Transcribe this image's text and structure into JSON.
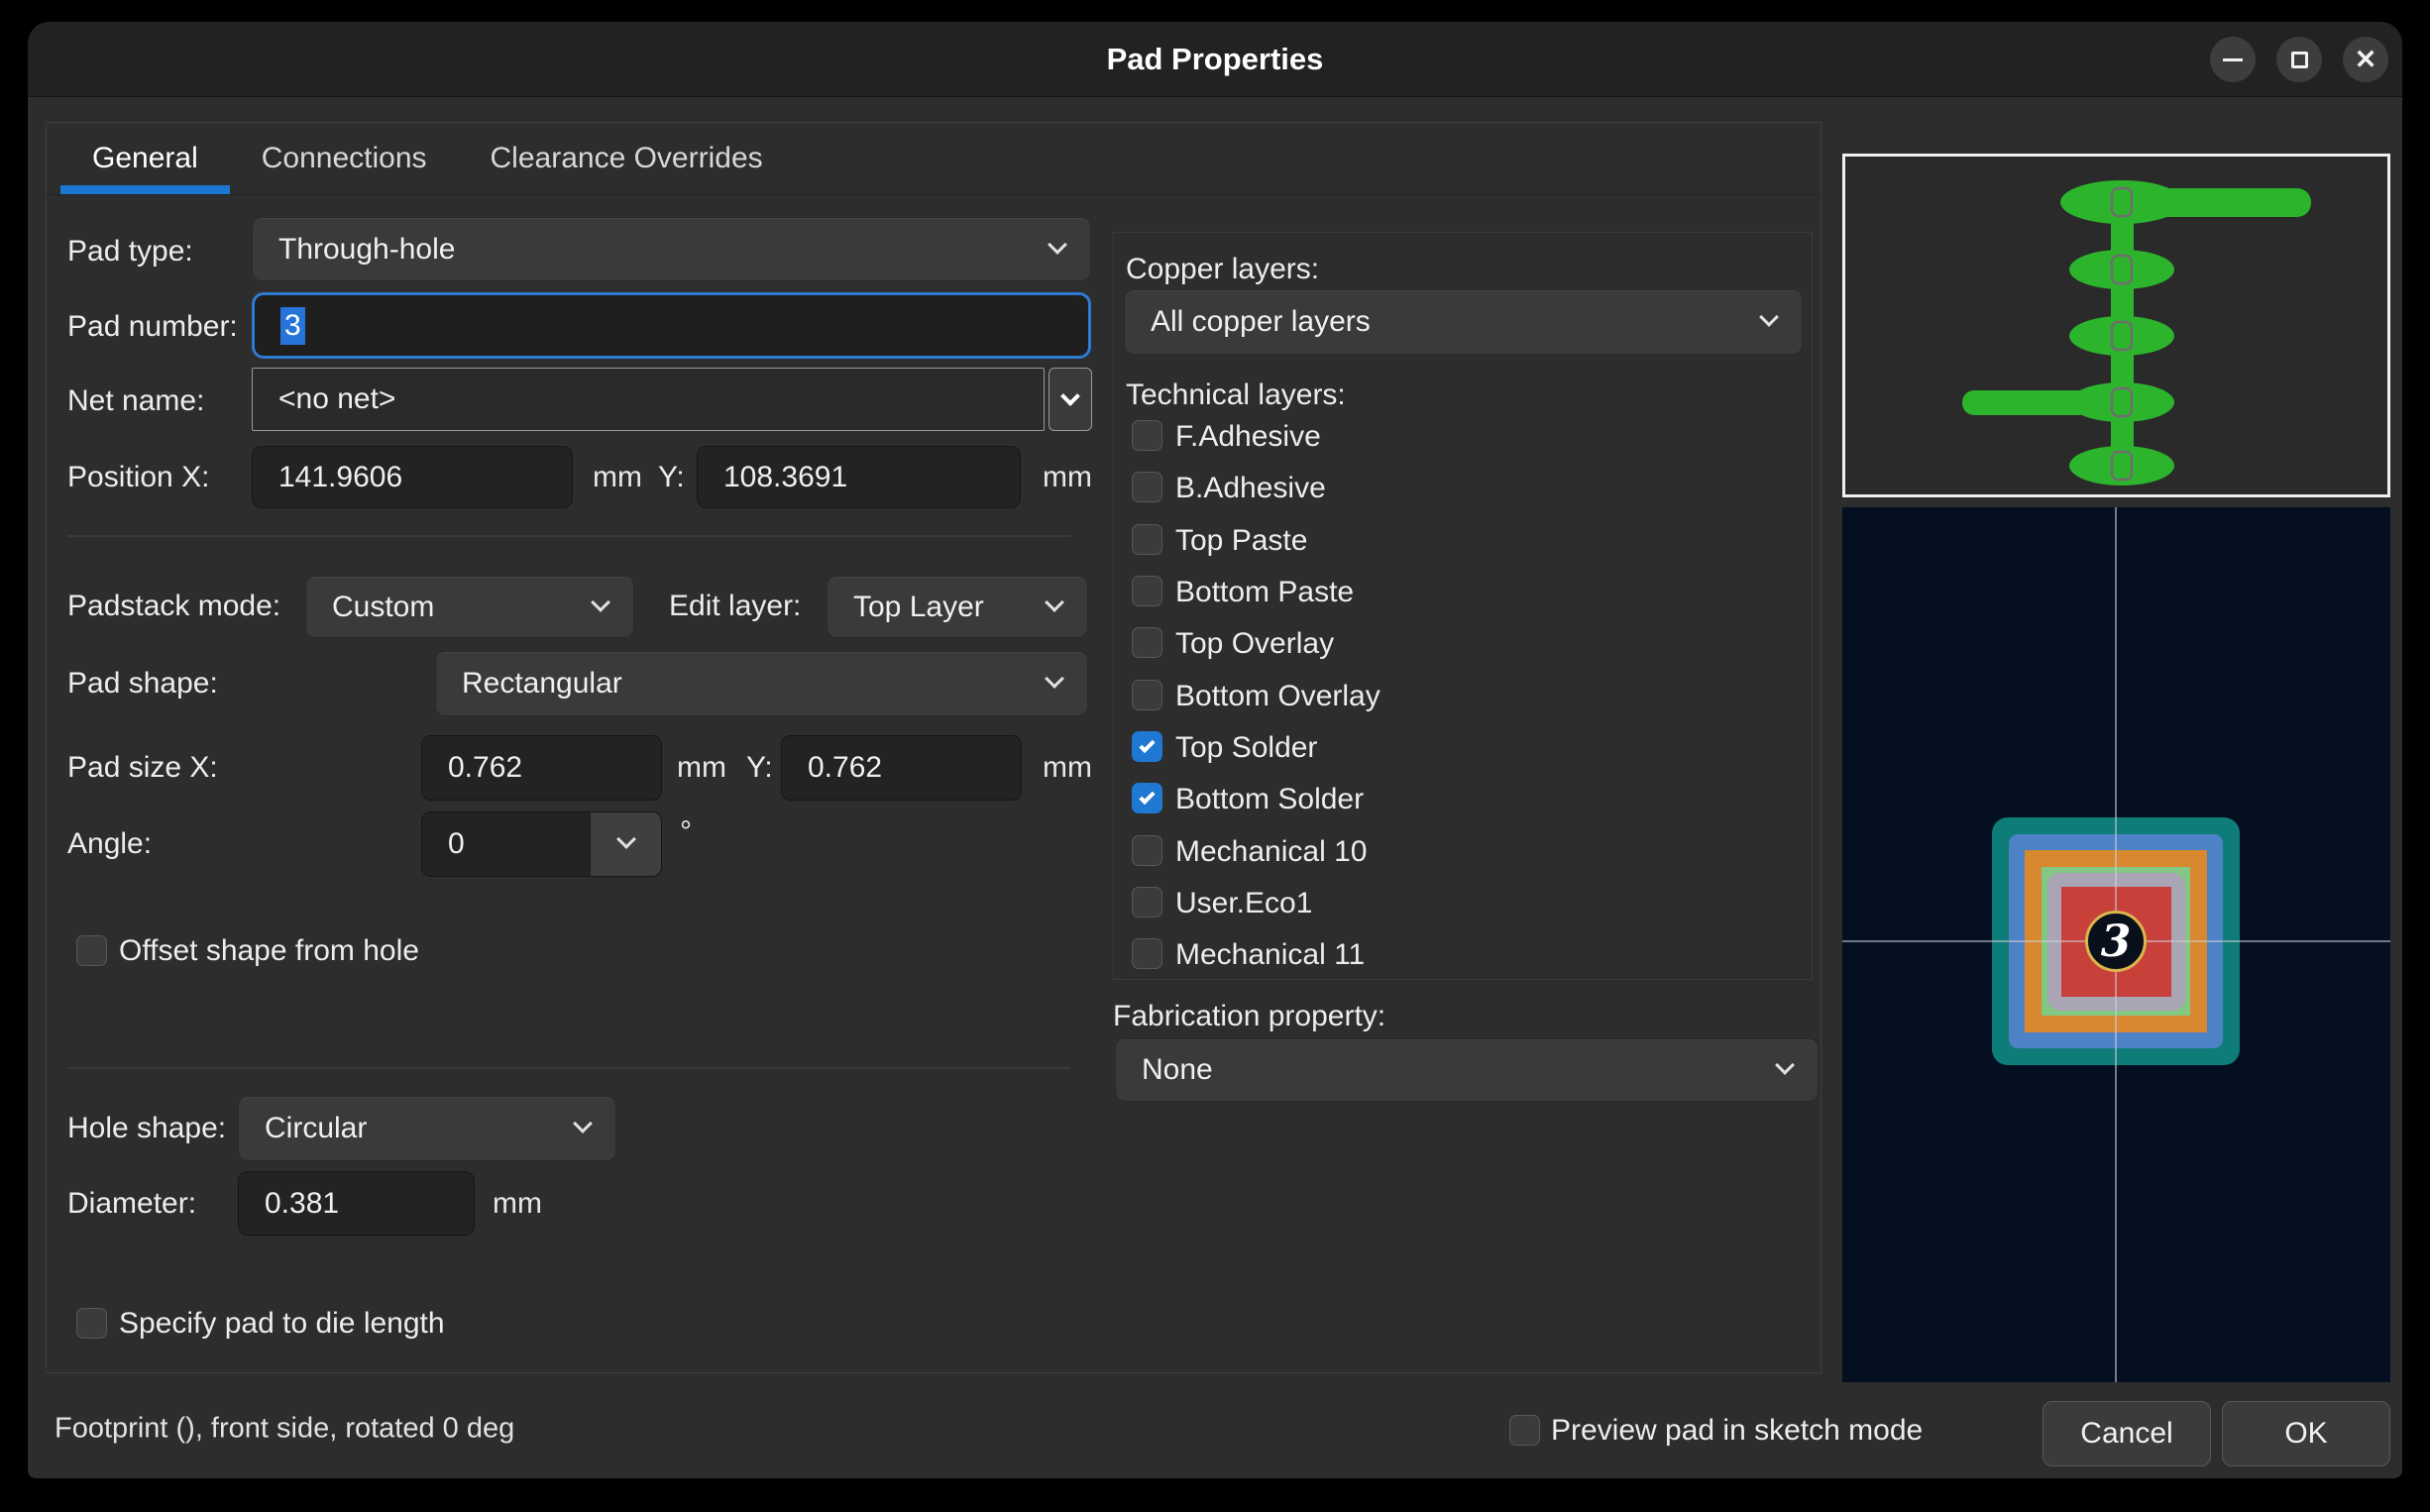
{
  "window": {
    "title": "Pad Properties"
  },
  "tabs": {
    "general": "General",
    "connections": "Connections",
    "clearance": "Clearance Overrides"
  },
  "form": {
    "pad_type_label": "Pad type:",
    "pad_type_value": "Through-hole",
    "pad_number_label": "Pad number:",
    "pad_number_value": "3",
    "net_name_label": "Net name:",
    "net_name_value": "<no net>",
    "position_label": "Position X:",
    "position_x": "141.9606",
    "position_y": "108.3691",
    "y_label": "Y:",
    "mm": "mm",
    "deg": "°",
    "padstack_label": "Padstack mode:",
    "padstack_value": "Custom",
    "edit_layer_label": "Edit layer:",
    "edit_layer_value": "Top Layer",
    "pad_shape_label": "Pad shape:",
    "pad_shape_value": "Rectangular",
    "pad_size_label": "Pad size X:",
    "pad_size_x": "0.762",
    "pad_size_y": "0.762",
    "angle_label": "Angle:",
    "angle_value": "0",
    "offset_label": "Offset shape from hole",
    "offset_checked": false,
    "hole_shape_label": "Hole shape:",
    "hole_shape_value": "Circular",
    "diameter_label": "Diameter:",
    "diameter_value": "0.381",
    "die_label": "Specify pad to die length",
    "die_checked": false
  },
  "layers": {
    "copper_label": "Copper layers:",
    "copper_value": "All copper layers",
    "technical_label": "Technical layers:",
    "items": [
      {
        "label": "F.Adhesive",
        "checked": false
      },
      {
        "label": "B.Adhesive",
        "checked": false
      },
      {
        "label": "Top Paste",
        "checked": false
      },
      {
        "label": "Bottom Paste",
        "checked": false
      },
      {
        "label": "Top Overlay",
        "checked": false
      },
      {
        "label": "Bottom Overlay",
        "checked": false
      },
      {
        "label": "Top Solder",
        "checked": true
      },
      {
        "label": "Bottom Solder",
        "checked": true
      },
      {
        "label": "Mechanical 10",
        "checked": false
      },
      {
        "label": "User.Eco1",
        "checked": false
      },
      {
        "label": "Mechanical 11",
        "checked": false
      }
    ],
    "fabrication_label": "Fabrication property:",
    "fabrication_value": "None"
  },
  "preview": {
    "pad_number": "3",
    "colors": {
      "copper_green": "#2cb52c",
      "board_bg": "#041022",
      "teal": "#0e7c78",
      "blue": "#4d82c6",
      "orange": "#d8882e",
      "green": "#82c784",
      "gray": "#a9a5b4",
      "red": "#c8403a",
      "ring": "#d9b64a"
    }
  },
  "footer": {
    "status": "Footprint  (), front side, rotated 0 deg",
    "sketch_label": "Preview pad in sketch mode",
    "sketch_checked": false,
    "cancel": "Cancel",
    "ok": "OK"
  }
}
